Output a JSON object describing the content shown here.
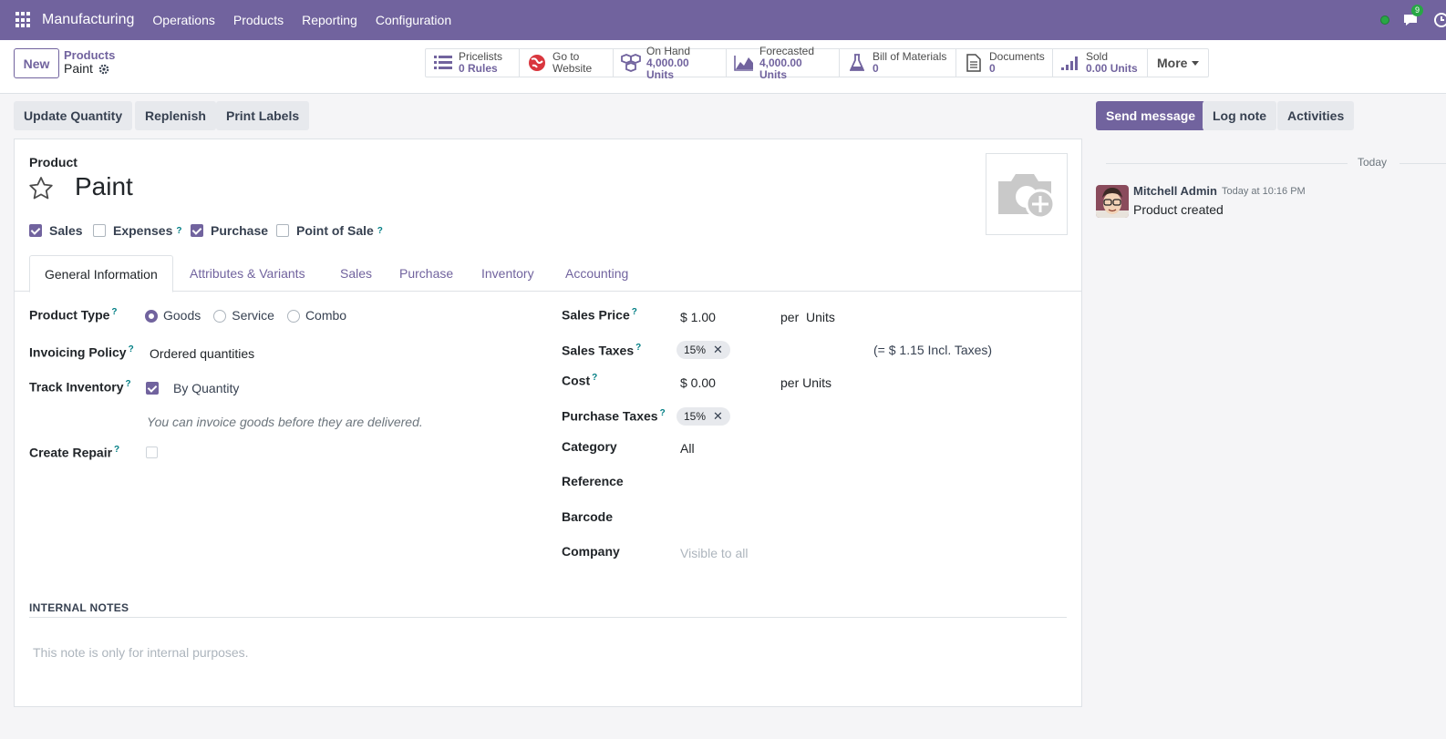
{
  "navbar": {
    "brand": "Manufacturing",
    "menu": [
      "Operations",
      "Products",
      "Reporting",
      "Configuration"
    ],
    "chat_count": "9",
    "accent": "#71639e"
  },
  "control": {
    "new_label": "New",
    "breadcrumb_parent": "Products",
    "breadcrumb_current": "Paint",
    "smart_buttons": [
      {
        "label": "Pricelists",
        "value": "0 Rules",
        "icon": "list-icon"
      },
      {
        "label": "Go to",
        "value": "Website",
        "icon": "globe-icon"
      },
      {
        "label": "On Hand",
        "value": "4,000.00 Units",
        "icon": "cubes-icon"
      },
      {
        "label": "Forecasted",
        "value": "4,000.00 Units",
        "icon": "area-chart-icon"
      },
      {
        "label": "Bill of Materials",
        "value": "0",
        "icon": "flask-icon"
      },
      {
        "label": "Documents",
        "value": "0",
        "icon": "file-icon"
      },
      {
        "label": "Sold",
        "value": "0.00 Units",
        "icon": "signal-icon"
      }
    ],
    "more_label": "More"
  },
  "actions": {
    "update_quantity": "Update Quantity",
    "replenish": "Replenish",
    "print_labels": "Print Labels",
    "send_message": "Send message",
    "log_note": "Log note",
    "activities": "Activities"
  },
  "form": {
    "product_label": "Product",
    "title": "Paint",
    "checkboxes": {
      "sales": {
        "label": "Sales",
        "checked": true
      },
      "expenses": {
        "label": "Expenses",
        "checked": false
      },
      "purchase": {
        "label": "Purchase",
        "checked": true
      },
      "pos": {
        "label": "Point of Sale",
        "checked": false
      }
    },
    "tabs": [
      "General Information",
      "Attributes & Variants",
      "Sales",
      "Purchase",
      "Inventory",
      "Accounting"
    ],
    "active_tab": "General Information",
    "left": {
      "product_type_label": "Product Type",
      "product_type_options": [
        "Goods",
        "Service",
        "Combo"
      ],
      "product_type_selected": "Goods",
      "invoicing_policy_label": "Invoicing Policy",
      "invoicing_policy_value": "Ordered quantities",
      "track_inventory_label": "Track Inventory",
      "track_inventory_value": "By Quantity",
      "invoice_hint": "You can invoice goods before they are delivered.",
      "create_repair_label": "Create Repair"
    },
    "right": {
      "sales_price_label": "Sales Price",
      "sales_price_value": "$ 1.00",
      "sales_price_per": "per  Units",
      "sales_taxes_label": "Sales Taxes",
      "sales_taxes_tag": "15%",
      "incl_taxes": "(= $ 1.15 Incl. Taxes)",
      "cost_label": "Cost",
      "cost_value": "$ 0.00",
      "cost_per": "per Units",
      "purchase_taxes_label": "Purchase Taxes",
      "purchase_taxes_tag": "15%",
      "category_label": "Category",
      "category_value": "All",
      "reference_label": "Reference",
      "barcode_label": "Barcode",
      "company_label": "Company",
      "company_placeholder": "Visible to all"
    },
    "notes_heading": "INTERNAL NOTES",
    "notes_placeholder": "This note is only for internal purposes."
  },
  "chatter": {
    "date": "Today",
    "author": "Mitchell Admin",
    "time": "Today at 10:16 PM",
    "body": "Product created"
  }
}
